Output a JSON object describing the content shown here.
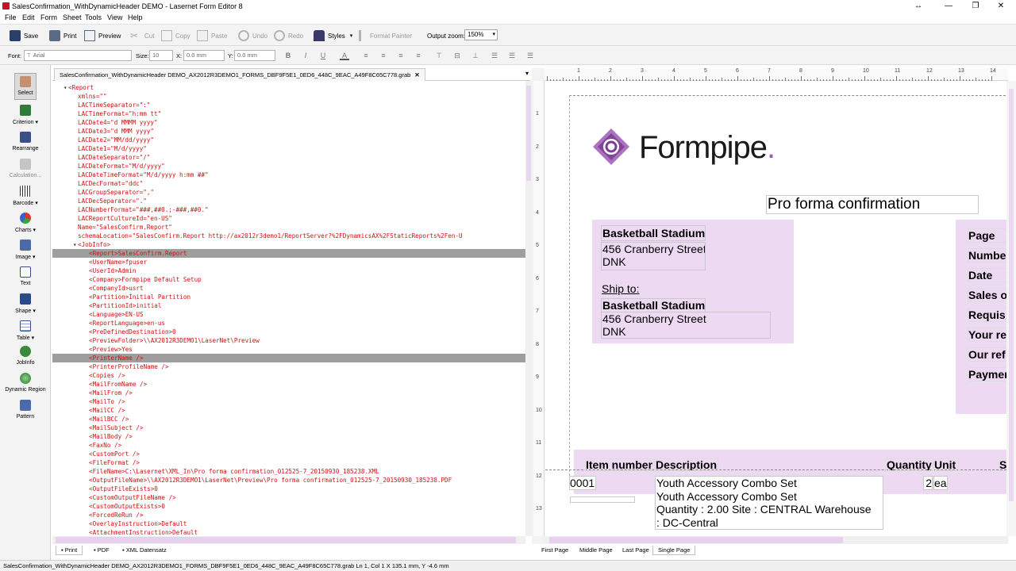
{
  "window": {
    "title": "SalesConfirmation_WithDynamicHeader DEMO - Lasernet Form Editor 8",
    "controls": [
      "↔",
      "—",
      "❐",
      "✕"
    ]
  },
  "menu": [
    "File",
    "Edit",
    "Form",
    "Sheet",
    "Tools",
    "View",
    "Help"
  ],
  "toolbar": {
    "save": "Save",
    "print": "Print",
    "preview": "Preview",
    "cut": "Cut",
    "copy": "Copy",
    "paste": "Paste",
    "undo": "Undo",
    "redo": "Redo",
    "styles": "Styles",
    "format_painter": "Format Painter",
    "output_zoom_label": "Output zoom:",
    "output_zoom": "150%"
  },
  "formatbar": {
    "font_label": "Font:",
    "font_value": "Arial",
    "size_label": "Size:",
    "size_value": "10",
    "x_label": "X:",
    "x_value": "0.0 mm",
    "y_label": "Y:",
    "y_value": "0.0 mm",
    "bold": "B",
    "italic": "I",
    "underline": "U",
    "color": "A"
  },
  "palette": [
    "Select",
    "Criterion",
    "Rearrange",
    "Calculation...",
    "Barcode",
    "Charts",
    "Image",
    "Text",
    "Shape",
    "Table",
    "JobInfo",
    "Dynamic Region",
    "Pattern"
  ],
  "editor_tab": "SalesConfirmation_WithDynamicHeader DEMO_AX2012R3DEMO1_FORMS_DBF9F5E1_0ED6_448C_9EAC_A49F8C65C778.grab",
  "xml_lines": [
    "<Report",
    "xmlns=\"\"",
    "LACTimeSeparator=\":\"",
    "LACTimeFormat=\"h:mm tt\"",
    "LACDate4=\"d MMMM yyyy\"",
    "LACDate3=\"d MMM yyyy\"",
    "LACDate2=\"MM/dd/yyyy\"",
    "LACDate1=\"M/d/yyyy\"",
    "LACDateSeparator=\"/\"",
    "LACDateFormat=\"M/d/yyyy\"",
    "LACDateTimeFormat=\"M/d/yyyy h:mm ##\"",
    "LACDecFormat=\"ddc\"",
    "LACGroupSeparator=\",\"",
    "LACDecSeparator=\".\"",
    "LACNumberFormat=\"###,##0.;-###,##0.\"",
    "LACReportCultureId=\"en-US\"",
    "Name=\"SalesConfirm.Report\"",
    "schemaLocation=\"SalesConfirm.Report http://ax2012r3demo1/ReportServer?%2FDynamicsAX%2FStaticReports%2Fen-U",
    "<JobInfo>",
    "<Report>SalesConfirm.Report",
    "<UserName>fpuser",
    "<UserId>Admin",
    "<Company>Formpipe Default Setup",
    "<CompanyId>usrt",
    "<Partition>Initial Partition",
    "<PartitionId>initial",
    "<Language>EN-US",
    "<ReportLanguage>en-us",
    "<PreDefinedDestination>0",
    "<PreviewFolder>\\\\AX2012R3DEMO1\\LaserNet\\Preview",
    "<Preview>Yes",
    "<PrinterName />",
    "<PrinterProfileName />",
    "<Copies />",
    "<MailFromName />",
    "<MailFrom />",
    "<MailTo />",
    "<MailCC />",
    "<MailBCC />",
    "<MailSubject />",
    "<MailBody />",
    "<FaxNo />",
    "<CustomPort />",
    "<FileFormat />",
    "<FileName>C:\\Lasernet\\XML_In\\Pro forma confirmation_012525-7_20150930_185238.XML",
    "<OutputFileName>\\\\AX2012R3DEMO1\\LaserNet\\Preview\\Pro forma confirmation_012525-7_20150930_185238.PDF",
    "<OutputFileExists>0",
    "<CustomOutputFileName />",
    "<CustomOutputExists>0",
    "<ForcedReRun />",
    "<OverlayInstruction>Default",
    "<AttachmentInstruction>Default"
  ],
  "bottom_tabs_left": [
    "Print",
    "PDF",
    "XML Datensatz"
  ],
  "bottom_tabs_right": [
    "First Page",
    "Middle Page",
    "Last Page",
    "Single Page"
  ],
  "status": "SalesConfirmation_WithDynamicHeader DEMO_AX2012R3DEMO1_FORMS_DBF9F5E1_0ED6_448C_9EAC_A49F8C65C778.grab   Ln 1, Col 1   X 135.1 mm, Y -4.6 mm",
  "ruler_h": [
    "1",
    "2",
    "3",
    "4",
    "5",
    "6",
    "7",
    "8",
    "9",
    "10",
    "11",
    "12",
    "13",
    "14"
  ],
  "ruler_v": [
    "1",
    "2",
    "3",
    "4",
    "5",
    "6",
    "7",
    "8",
    "9",
    "10",
    "11",
    "12",
    "13"
  ],
  "form": {
    "logo_text": "Formpipe",
    "logo_dot": ".",
    "doc_title": "Pro forma confirmation",
    "bill_name": "Basketball Stadium",
    "bill_street": "456 Cranberry Street",
    "bill_country": "DNK",
    "ship_to": "Ship to:",
    "ship_name": "Basketball Stadium",
    "ship_street": "456 Cranberry Street",
    "ship_country": "DNK",
    "right_labels": [
      "Page",
      "Numbe",
      "Date",
      "Sales o",
      "Requis",
      "Your re",
      "Our ref",
      "Paymen"
    ],
    "columns": [
      "Item number",
      "Description",
      "Quantity",
      "Unit",
      "S"
    ],
    "line": {
      "item": "0001",
      "desc1": "Youth Accessory Combo Set",
      "desc2": "Youth Accessory Combo Set",
      "desc3": "Quantity : 2.00  Site : CENTRAL   Warehouse",
      "desc4": ": DC-Central",
      "qty": "2",
      "unit": "ea"
    }
  }
}
